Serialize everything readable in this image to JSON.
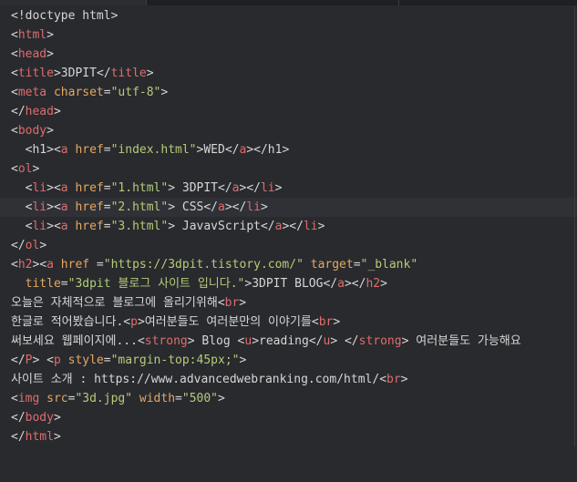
{
  "lines": [
    [
      [
        "t",
        "<!doctype html>"
      ]
    ],
    [
      [
        "p",
        "<"
      ],
      [
        "g",
        "html"
      ],
      [
        "p",
        ">"
      ]
    ],
    [
      [
        "p",
        "<"
      ],
      [
        "g",
        "head"
      ],
      [
        "p",
        ">"
      ]
    ],
    [
      [
        "p",
        "<"
      ],
      [
        "g",
        "title"
      ],
      [
        "p",
        ">"
      ],
      [
        "t",
        "3DPIT"
      ],
      [
        "p",
        "</"
      ],
      [
        "g",
        "title"
      ],
      [
        "p",
        ">"
      ]
    ],
    [
      [
        "p",
        "<"
      ],
      [
        "g",
        "meta"
      ],
      [
        "t",
        " "
      ],
      [
        "a",
        "charset"
      ],
      [
        "t",
        "="
      ],
      [
        "s",
        "\"utf-8\""
      ],
      [
        "p",
        ">"
      ]
    ],
    [
      [
        "p",
        "</"
      ],
      [
        "g",
        "head"
      ],
      [
        "p",
        ">"
      ]
    ],
    [
      [
        "p",
        "<"
      ],
      [
        "g",
        "body"
      ],
      [
        "p",
        ">"
      ]
    ],
    [
      [
        "t",
        "  "
      ],
      [
        "p",
        "<"
      ],
      [
        "t",
        "h1"
      ],
      [
        "p",
        ">"
      ],
      [
        "p",
        "<"
      ],
      [
        "g",
        "a"
      ],
      [
        "t",
        " "
      ],
      [
        "a",
        "href"
      ],
      [
        "t",
        "="
      ],
      [
        "s",
        "\"index.html\""
      ],
      [
        "p",
        ">"
      ],
      [
        "t",
        "WED"
      ],
      [
        "p",
        "</"
      ],
      [
        "g",
        "a"
      ],
      [
        "p",
        ">"
      ],
      [
        "p",
        "</"
      ],
      [
        "t",
        "h1"
      ],
      [
        "p",
        ">"
      ]
    ],
    [
      [
        "p",
        "<"
      ],
      [
        "g",
        "ol"
      ],
      [
        "p",
        ">"
      ]
    ],
    [
      [
        "t",
        "  "
      ],
      [
        "p",
        "<"
      ],
      [
        "g",
        "li"
      ],
      [
        "p",
        ">"
      ],
      [
        "p",
        "<"
      ],
      [
        "g",
        "a"
      ],
      [
        "t",
        " "
      ],
      [
        "a",
        "href"
      ],
      [
        "t",
        "="
      ],
      [
        "s",
        "\"1.html\""
      ],
      [
        "p",
        ">"
      ],
      [
        "t",
        " 3DPIT"
      ],
      [
        "p",
        "</"
      ],
      [
        "g",
        "a"
      ],
      [
        "p",
        ">"
      ],
      [
        "p",
        "</"
      ],
      [
        "g",
        "li"
      ],
      [
        "p",
        ">"
      ]
    ],
    [
      [
        "t",
        "  "
      ],
      [
        "p",
        "<"
      ],
      [
        "g",
        "li"
      ],
      [
        "p",
        ">"
      ],
      [
        "p",
        "<"
      ],
      [
        "g",
        "a"
      ],
      [
        "t",
        " "
      ],
      [
        "a",
        "href"
      ],
      [
        "t",
        "="
      ],
      [
        "s",
        "\"2.html\""
      ],
      [
        "p",
        ">"
      ],
      [
        "t",
        " CSS"
      ],
      [
        "p",
        "</"
      ],
      [
        "g",
        "a"
      ],
      [
        "p",
        ">"
      ],
      [
        "p",
        "</"
      ],
      [
        "g",
        "li"
      ],
      [
        "p",
        ">"
      ]
    ],
    [
      [
        "t",
        "  "
      ],
      [
        "p",
        "<"
      ],
      [
        "g",
        "li"
      ],
      [
        "p",
        ">"
      ],
      [
        "p",
        "<"
      ],
      [
        "g",
        "a"
      ],
      [
        "t",
        " "
      ],
      [
        "a",
        "href"
      ],
      [
        "t",
        "="
      ],
      [
        "s",
        "\"3.html\""
      ],
      [
        "p",
        ">"
      ],
      [
        "t",
        " JavavScript"
      ],
      [
        "p",
        "</"
      ],
      [
        "g",
        "a"
      ],
      [
        "p",
        ">"
      ],
      [
        "p",
        "</"
      ],
      [
        "g",
        "li"
      ],
      [
        "p",
        ">"
      ]
    ],
    [
      [
        "p",
        "</"
      ],
      [
        "g",
        "ol"
      ],
      [
        "p",
        ">"
      ]
    ],
    [
      [
        "p",
        "<"
      ],
      [
        "g",
        "h2"
      ],
      [
        "p",
        ">"
      ],
      [
        "p",
        "<"
      ],
      [
        "g",
        "a"
      ],
      [
        "t",
        " "
      ],
      [
        "a",
        "href"
      ],
      [
        "t",
        " ="
      ],
      [
        "s",
        "\"https://3dpit.tistory.com/\""
      ],
      [
        "t",
        " "
      ],
      [
        "a",
        "target"
      ],
      [
        "t",
        "="
      ],
      [
        "s",
        "\"_blank\""
      ]
    ],
    [
      [
        "t",
        "  "
      ],
      [
        "a",
        "title"
      ],
      [
        "t",
        "="
      ],
      [
        "s",
        "\"3dpit 블로그 사이트 입니다.\""
      ],
      [
        "p",
        ">"
      ],
      [
        "t",
        "3DPIT BLOG"
      ],
      [
        "p",
        "</"
      ],
      [
        "g",
        "a"
      ],
      [
        "p",
        ">"
      ],
      [
        "p",
        "</"
      ],
      [
        "g",
        "h2"
      ],
      [
        "p",
        ">"
      ]
    ],
    [
      [
        "t",
        "오늘은 자체적으로 블로그에 올리기위해"
      ],
      [
        "p",
        "<"
      ],
      [
        "g",
        "br"
      ],
      [
        "p",
        ">"
      ]
    ],
    [
      [
        "t",
        "한글로 적어봤습니다."
      ],
      [
        "p",
        "<"
      ],
      [
        "g",
        "p"
      ],
      [
        "p",
        ">"
      ],
      [
        "t",
        "여러분들도 여러분만의 이야기를"
      ],
      [
        "p",
        "<"
      ],
      [
        "g",
        "br"
      ],
      [
        "p",
        ">"
      ]
    ],
    [
      [
        "t",
        "써보세요 웹페이지에..."
      ],
      [
        "p",
        "<"
      ],
      [
        "g",
        "strong"
      ],
      [
        "p",
        ">"
      ],
      [
        "t",
        " Blog "
      ],
      [
        "p",
        "<"
      ],
      [
        "g",
        "u"
      ],
      [
        "p",
        ">"
      ],
      [
        "t",
        "reading"
      ],
      [
        "p",
        "</"
      ],
      [
        "g",
        "u"
      ],
      [
        "p",
        ">"
      ],
      [
        "t",
        " "
      ],
      [
        "p",
        "</"
      ],
      [
        "g",
        "strong"
      ],
      [
        "p",
        ">"
      ],
      [
        "t",
        " 여러분들도 가능해요"
      ]
    ],
    [
      [
        "p",
        "</"
      ],
      [
        "g",
        "P"
      ],
      [
        "p",
        ">"
      ],
      [
        "t",
        " "
      ],
      [
        "p",
        "<"
      ],
      [
        "g",
        "p"
      ],
      [
        "t",
        " "
      ],
      [
        "a",
        "style"
      ],
      [
        "t",
        "="
      ],
      [
        "s",
        "\"margin-top:45px;\""
      ],
      [
        "p",
        ">"
      ]
    ],
    [
      [
        "t",
        "사이트 소개 : https://www.advancedwebranking.com/html/"
      ],
      [
        "p",
        "<"
      ],
      [
        "g",
        "br"
      ],
      [
        "p",
        ">"
      ]
    ],
    [
      [
        "p",
        "<"
      ],
      [
        "g",
        "img"
      ],
      [
        "t",
        " "
      ],
      [
        "a",
        "src"
      ],
      [
        "t",
        "="
      ],
      [
        "s",
        "\"3d.jpg\""
      ],
      [
        "t",
        " "
      ],
      [
        "a",
        "width"
      ],
      [
        "t",
        "="
      ],
      [
        "s",
        "\"500\""
      ],
      [
        "p",
        ">"
      ]
    ],
    [
      [
        "p",
        "</"
      ],
      [
        "g",
        "body"
      ],
      [
        "p",
        ">"
      ]
    ],
    [
      [
        "p",
        "</"
      ],
      [
        "g",
        "html"
      ],
      [
        "p",
        ">"
      ]
    ]
  ],
  "cursor_line": 10,
  "colors": {
    "tag": "#e06c6c",
    "attribute": "#e6a75e",
    "string": "#b5cc78",
    "text": "#d6d6d6",
    "background": "#282a2e"
  }
}
